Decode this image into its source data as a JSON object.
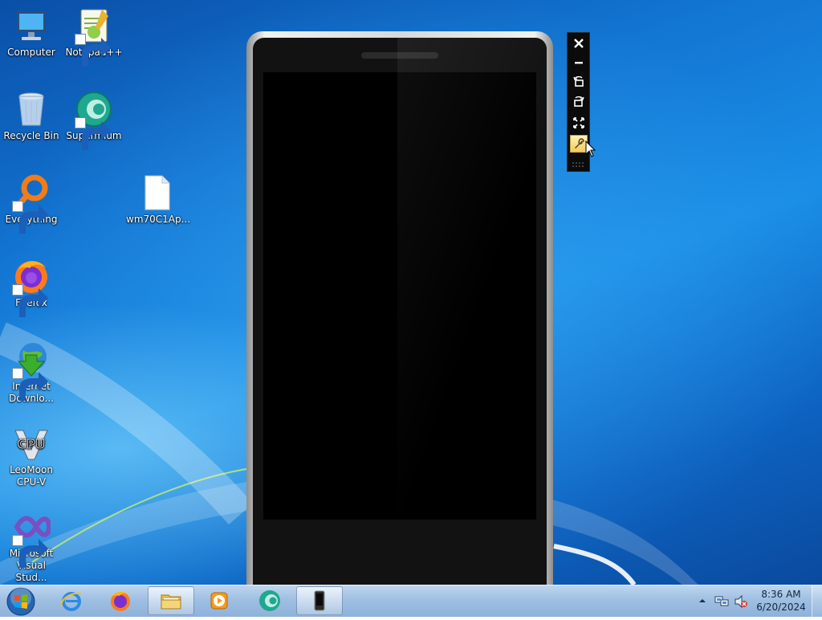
{
  "desktop": {
    "icons": [
      {
        "label": "Computer",
        "icon": "computer-icon",
        "shortcut": false
      },
      {
        "label": "Notepad++",
        "icon": "notepadpp-icon",
        "shortcut": true
      },
      {
        "label": "Recycle Bin",
        "icon": "recycle-bin-icon",
        "shortcut": false
      },
      {
        "label": "Supermium",
        "icon": "supermium-icon",
        "shortcut": true
      },
      {
        "label": "Everything",
        "icon": "everything-icon",
        "shortcut": true
      },
      {
        "label": "wm70C1Ap...",
        "icon": "file-icon",
        "shortcut": false
      },
      {
        "label": "Firefox",
        "icon": "firefox-icon",
        "shortcut": true
      },
      {
        "label": "Internet Downlo...",
        "icon": "idm-icon",
        "shortcut": true
      },
      {
        "label": "LeoMoon CPU-V",
        "icon": "cpu-v-icon",
        "shortcut": false
      },
      {
        "label": "Microsoft Visual Stud...",
        "icon": "visual-studio-icon",
        "shortcut": true
      }
    ]
  },
  "emulator": {
    "status_icon": "airplane-mode-icon",
    "toolbar": [
      "close-icon",
      "minimize-icon",
      "rotate-left-icon",
      "rotate-right-icon",
      "fit-to-screen-icon",
      "additional-tools-icon"
    ]
  },
  "taskbar": {
    "items": [
      "internet-explorer",
      "firefox",
      "windows-explorer",
      "media-player",
      "supermium",
      "windows-phone-emulator"
    ],
    "active_item": "windows-phone-emulator",
    "tray_icons": [
      "show-hidden-icons",
      "network-icon",
      "volume-muted-icon"
    ],
    "clock": {
      "time": "8:36 AM",
      "date": "6/20/2024"
    }
  }
}
